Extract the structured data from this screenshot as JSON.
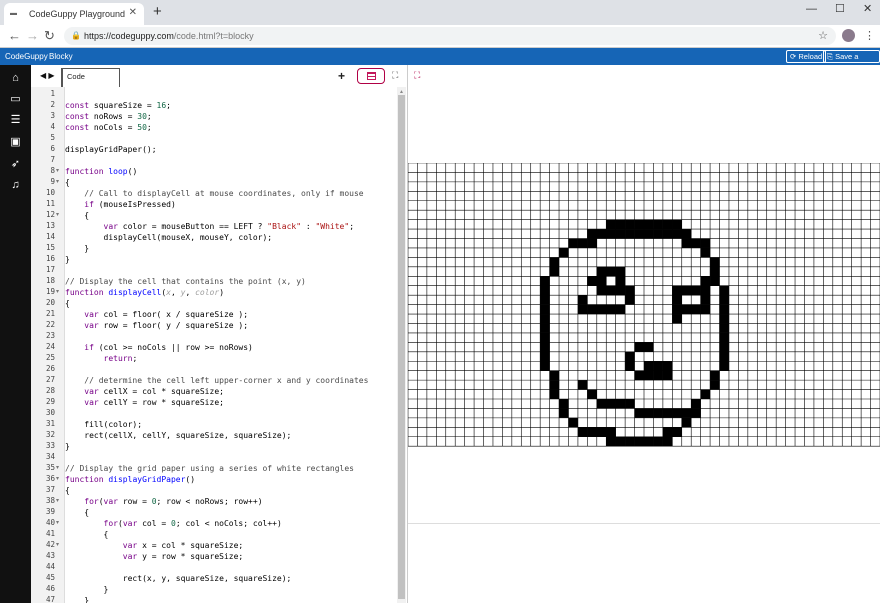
{
  "browser": {
    "tab_title": "CodeGuppy Playground",
    "url_host": "https://codeguppy.com",
    "url_rest": "/code.html?t=blocky"
  },
  "appbar": {
    "brand": "CodeGuppy",
    "menu_item": "Blocky",
    "reload_label": "Reload",
    "save_label": "Save a copy"
  },
  "sidebar": {
    "items": [
      {
        "icon": "home-icon"
      },
      {
        "icon": "book-icon"
      },
      {
        "icon": "list-icon"
      },
      {
        "icon": "image-icon"
      },
      {
        "icon": "rocket-icon"
      },
      {
        "icon": "music-icon"
      }
    ]
  },
  "editor": {
    "tab_label": "Code",
    "line_count": 47,
    "folds": [
      8,
      9,
      12,
      19,
      35,
      36,
      38,
      40,
      42
    ],
    "lines": [
      [],
      [
        [
          "kw",
          "const"
        ],
        [
          "txt",
          " squareSize = "
        ],
        [
          "num",
          "16"
        ],
        [
          "txt",
          ";"
        ]
      ],
      [
        [
          "kw",
          "const"
        ],
        [
          "txt",
          " noRows = "
        ],
        [
          "num",
          "30"
        ],
        [
          "txt",
          ";"
        ]
      ],
      [
        [
          "kw",
          "const"
        ],
        [
          "txt",
          " noCols = "
        ],
        [
          "num",
          "50"
        ],
        [
          "txt",
          ";"
        ]
      ],
      [],
      [
        [
          "txt",
          "displayGridPaper();"
        ]
      ],
      [],
      [
        [
          "kw",
          "function"
        ],
        [
          "txt",
          " "
        ],
        [
          "def",
          "loop"
        ],
        [
          "txt",
          "()"
        ]
      ],
      [
        [
          "txt",
          "{"
        ]
      ],
      [
        [
          "cmt",
          "    // Call to displayCell at mouse coordinates, only if mouse"
        ]
      ],
      [
        [
          "txt",
          "    "
        ],
        [
          "kw",
          "if"
        ],
        [
          "txt",
          " (mouseIsPressed)"
        ]
      ],
      [
        [
          "txt",
          "    {"
        ]
      ],
      [
        [
          "txt",
          "        "
        ],
        [
          "kw",
          "var"
        ],
        [
          "txt",
          " color = mouseButton == LEFT ? "
        ],
        [
          "str",
          "\"Black\""
        ],
        [
          "txt",
          " : "
        ],
        [
          "str",
          "\"White\""
        ],
        [
          "txt",
          ";"
        ]
      ],
      [
        [
          "txt",
          "        displayCell(mouseX, mouseY, color);"
        ]
      ],
      [
        [
          "txt",
          "    }"
        ]
      ],
      [
        [
          "txt",
          "}"
        ]
      ],
      [],
      [
        [
          "cmt",
          "// Display the cell that contains the point (x, y)"
        ]
      ],
      [
        [
          "kw",
          "function"
        ],
        [
          "txt",
          " "
        ],
        [
          "def",
          "displayCell"
        ],
        [
          "txt",
          "("
        ],
        [
          "param",
          "x"
        ],
        [
          "txt",
          ", "
        ],
        [
          "param",
          "y"
        ],
        [
          "txt",
          ", "
        ],
        [
          "param",
          "color"
        ],
        [
          "txt",
          ")"
        ]
      ],
      [
        [
          "txt",
          "{"
        ]
      ],
      [
        [
          "txt",
          "    "
        ],
        [
          "kw",
          "var"
        ],
        [
          "txt",
          " col = floor( x / squareSize );"
        ]
      ],
      [
        [
          "txt",
          "    "
        ],
        [
          "kw",
          "var"
        ],
        [
          "txt",
          " row = floor( y / squareSize );"
        ]
      ],
      [],
      [
        [
          "txt",
          "    "
        ],
        [
          "kw",
          "if"
        ],
        [
          "txt",
          " (col >= noCols || row >= noRows)"
        ]
      ],
      [
        [
          "txt",
          "        "
        ],
        [
          "kw",
          "return"
        ],
        [
          "txt",
          ";"
        ]
      ],
      [],
      [
        [
          "cmt",
          "    // determine the cell left upper-corner x and y coordinates"
        ]
      ],
      [
        [
          "txt",
          "    "
        ],
        [
          "kw",
          "var"
        ],
        [
          "txt",
          " cellX = col * squareSize;"
        ]
      ],
      [
        [
          "txt",
          "    "
        ],
        [
          "kw",
          "var"
        ],
        [
          "txt",
          " cellY = row * squareSize;"
        ]
      ],
      [],
      [
        [
          "txt",
          "    fill(color);"
        ]
      ],
      [
        [
          "txt",
          "    rect(cellX, cellY, squareSize, squareSize);"
        ]
      ],
      [
        [
          "txt",
          "}"
        ]
      ],
      [],
      [
        [
          "cmt",
          "// Display the grid paper using a series of white rectangles"
        ]
      ],
      [
        [
          "kw",
          "function"
        ],
        [
          "txt",
          " "
        ],
        [
          "def",
          "displayGridPaper"
        ],
        [
          "txt",
          "()"
        ]
      ],
      [
        [
          "txt",
          "{"
        ]
      ],
      [
        [
          "txt",
          "    "
        ],
        [
          "kw",
          "for"
        ],
        [
          "txt",
          "("
        ],
        [
          "kw",
          "var"
        ],
        [
          "txt",
          " row = "
        ],
        [
          "num",
          "0"
        ],
        [
          "txt",
          "; row < noRows; row++)"
        ]
      ],
      [
        [
          "txt",
          "    {"
        ]
      ],
      [
        [
          "txt",
          "        "
        ],
        [
          "kw",
          "for"
        ],
        [
          "txt",
          "("
        ],
        [
          "kw",
          "var"
        ],
        [
          "txt",
          " col = "
        ],
        [
          "num",
          "0"
        ],
        [
          "txt",
          "; col < noCols; col++)"
        ]
      ],
      [
        [
          "txt",
          "        {"
        ]
      ],
      [
        [
          "txt",
          "            "
        ],
        [
          "kw",
          "var"
        ],
        [
          "txt",
          " x = col * squareSize;"
        ]
      ],
      [
        [
          "txt",
          "            "
        ],
        [
          "kw",
          "var"
        ],
        [
          "txt",
          " y = row * squareSize;"
        ]
      ],
      [],
      [
        [
          "txt",
          "            rect(x, y, squareSize, squareSize);"
        ]
      ],
      [
        [
          "txt",
          "        }"
        ]
      ],
      [
        [
          "txt",
          "    }"
        ]
      ]
    ]
  },
  "output": {
    "grid_cols": 50,
    "grid_rows": 30,
    "black_cells": [
      "6:21-28",
      "7:19-29",
      "8:17-19",
      "8:29-31",
      "9:16",
      "9:31",
      "10:15",
      "10:32",
      "11:15",
      "11:20-22",
      "11:32",
      "12:14",
      "12:19-20",
      "12:22",
      "12:32",
      "12:31",
      "13:14",
      "13:20-23",
      "13:28-31",
      "13:33",
      "14:14",
      "14:18",
      "14:23",
      "14:28",
      "14:31",
      "14:33",
      "15:14",
      "15:18-22",
      "15:28-31",
      "15:33",
      "16:14",
      "16:28",
      "16:33",
      "17:14",
      "17:33",
      "18:14",
      "18:33",
      "19:14",
      "19:24-25",
      "19:33",
      "20:14",
      "20:23",
      "20:33",
      "21:14",
      "21:23",
      "21:25-27",
      "21:33",
      "22:15",
      "22:24-27",
      "22:32",
      "23:15",
      "23:18",
      "23:32",
      "24:15",
      "24:19",
      "24:31",
      "25:16",
      "25:20-23",
      "25:30",
      "26:16",
      "26:24-30",
      "27:17",
      "27:29",
      "28:18-21",
      "28:27-28",
      "29:21-27"
    ]
  }
}
